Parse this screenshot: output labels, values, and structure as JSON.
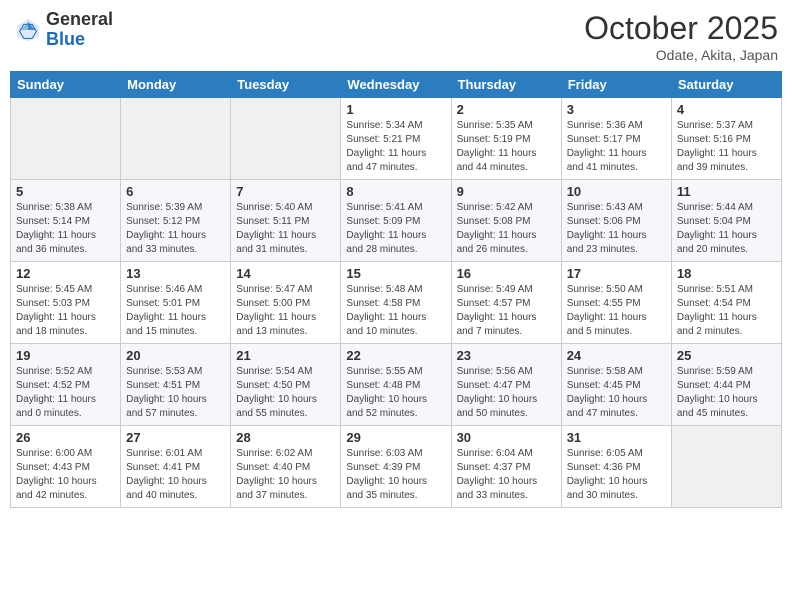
{
  "logo": {
    "general": "General",
    "blue": "Blue"
  },
  "header": {
    "month": "October 2025",
    "location": "Odate, Akita, Japan"
  },
  "weekdays": [
    "Sunday",
    "Monday",
    "Tuesday",
    "Wednesday",
    "Thursday",
    "Friday",
    "Saturday"
  ],
  "weeks": [
    [
      {
        "day": "",
        "info": ""
      },
      {
        "day": "",
        "info": ""
      },
      {
        "day": "",
        "info": ""
      },
      {
        "day": "1",
        "info": "Sunrise: 5:34 AM\nSunset: 5:21 PM\nDaylight: 11 hours\nand 47 minutes."
      },
      {
        "day": "2",
        "info": "Sunrise: 5:35 AM\nSunset: 5:19 PM\nDaylight: 11 hours\nand 44 minutes."
      },
      {
        "day": "3",
        "info": "Sunrise: 5:36 AM\nSunset: 5:17 PM\nDaylight: 11 hours\nand 41 minutes."
      },
      {
        "day": "4",
        "info": "Sunrise: 5:37 AM\nSunset: 5:16 PM\nDaylight: 11 hours\nand 39 minutes."
      }
    ],
    [
      {
        "day": "5",
        "info": "Sunrise: 5:38 AM\nSunset: 5:14 PM\nDaylight: 11 hours\nand 36 minutes."
      },
      {
        "day": "6",
        "info": "Sunrise: 5:39 AM\nSunset: 5:12 PM\nDaylight: 11 hours\nand 33 minutes."
      },
      {
        "day": "7",
        "info": "Sunrise: 5:40 AM\nSunset: 5:11 PM\nDaylight: 11 hours\nand 31 minutes."
      },
      {
        "day": "8",
        "info": "Sunrise: 5:41 AM\nSunset: 5:09 PM\nDaylight: 11 hours\nand 28 minutes."
      },
      {
        "day": "9",
        "info": "Sunrise: 5:42 AM\nSunset: 5:08 PM\nDaylight: 11 hours\nand 26 minutes."
      },
      {
        "day": "10",
        "info": "Sunrise: 5:43 AM\nSunset: 5:06 PM\nDaylight: 11 hours\nand 23 minutes."
      },
      {
        "day": "11",
        "info": "Sunrise: 5:44 AM\nSunset: 5:04 PM\nDaylight: 11 hours\nand 20 minutes."
      }
    ],
    [
      {
        "day": "12",
        "info": "Sunrise: 5:45 AM\nSunset: 5:03 PM\nDaylight: 11 hours\nand 18 minutes."
      },
      {
        "day": "13",
        "info": "Sunrise: 5:46 AM\nSunset: 5:01 PM\nDaylight: 11 hours\nand 15 minutes."
      },
      {
        "day": "14",
        "info": "Sunrise: 5:47 AM\nSunset: 5:00 PM\nDaylight: 11 hours\nand 13 minutes."
      },
      {
        "day": "15",
        "info": "Sunrise: 5:48 AM\nSunset: 4:58 PM\nDaylight: 11 hours\nand 10 minutes."
      },
      {
        "day": "16",
        "info": "Sunrise: 5:49 AM\nSunset: 4:57 PM\nDaylight: 11 hours\nand 7 minutes."
      },
      {
        "day": "17",
        "info": "Sunrise: 5:50 AM\nSunset: 4:55 PM\nDaylight: 11 hours\nand 5 minutes."
      },
      {
        "day": "18",
        "info": "Sunrise: 5:51 AM\nSunset: 4:54 PM\nDaylight: 11 hours\nand 2 minutes."
      }
    ],
    [
      {
        "day": "19",
        "info": "Sunrise: 5:52 AM\nSunset: 4:52 PM\nDaylight: 11 hours\nand 0 minutes."
      },
      {
        "day": "20",
        "info": "Sunrise: 5:53 AM\nSunset: 4:51 PM\nDaylight: 10 hours\nand 57 minutes."
      },
      {
        "day": "21",
        "info": "Sunrise: 5:54 AM\nSunset: 4:50 PM\nDaylight: 10 hours\nand 55 minutes."
      },
      {
        "day": "22",
        "info": "Sunrise: 5:55 AM\nSunset: 4:48 PM\nDaylight: 10 hours\nand 52 minutes."
      },
      {
        "day": "23",
        "info": "Sunrise: 5:56 AM\nSunset: 4:47 PM\nDaylight: 10 hours\nand 50 minutes."
      },
      {
        "day": "24",
        "info": "Sunrise: 5:58 AM\nSunset: 4:45 PM\nDaylight: 10 hours\nand 47 minutes."
      },
      {
        "day": "25",
        "info": "Sunrise: 5:59 AM\nSunset: 4:44 PM\nDaylight: 10 hours\nand 45 minutes."
      }
    ],
    [
      {
        "day": "26",
        "info": "Sunrise: 6:00 AM\nSunset: 4:43 PM\nDaylight: 10 hours\nand 42 minutes."
      },
      {
        "day": "27",
        "info": "Sunrise: 6:01 AM\nSunset: 4:41 PM\nDaylight: 10 hours\nand 40 minutes."
      },
      {
        "day": "28",
        "info": "Sunrise: 6:02 AM\nSunset: 4:40 PM\nDaylight: 10 hours\nand 37 minutes."
      },
      {
        "day": "29",
        "info": "Sunrise: 6:03 AM\nSunset: 4:39 PM\nDaylight: 10 hours\nand 35 minutes."
      },
      {
        "day": "30",
        "info": "Sunrise: 6:04 AM\nSunset: 4:37 PM\nDaylight: 10 hours\nand 33 minutes."
      },
      {
        "day": "31",
        "info": "Sunrise: 6:05 AM\nSunset: 4:36 PM\nDaylight: 10 hours\nand 30 minutes."
      },
      {
        "day": "",
        "info": ""
      }
    ]
  ]
}
